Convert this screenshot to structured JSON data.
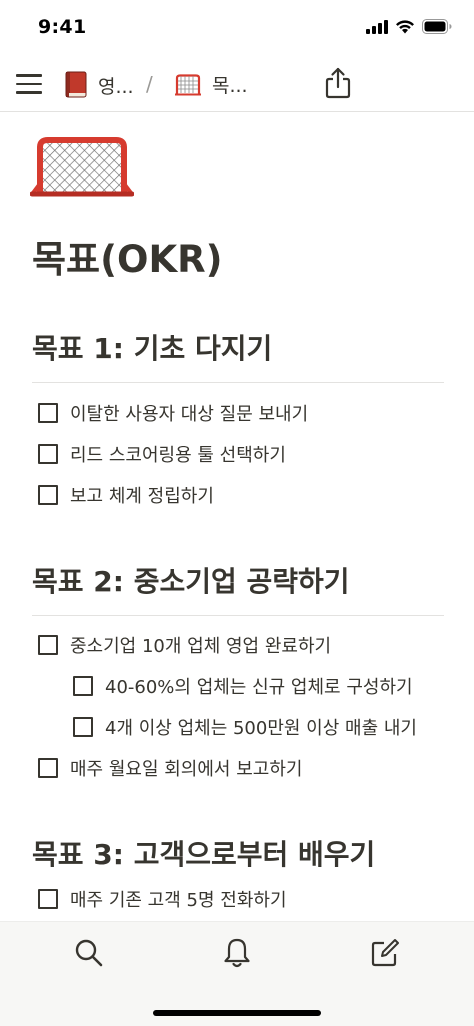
{
  "status": {
    "time": "9:41"
  },
  "nav": {
    "breadcrumbs": [
      {
        "icon": "red-book-icon",
        "label": "영..."
      },
      {
        "icon": "goal-net-icon",
        "label": "목..."
      }
    ],
    "separator": "/"
  },
  "page": {
    "icon": "goal-net-icon",
    "title": "목표(OKR)"
  },
  "sections": [
    {
      "heading": "목표 1: 기초 다지기",
      "todos": [
        {
          "text": "이탈한 사용자 대상 질문 보내기",
          "checked": false
        },
        {
          "text": "리드 스코어링용 툴 선택하기",
          "checked": false
        },
        {
          "text": "보고 체계 정립하기",
          "checked": false
        }
      ]
    },
    {
      "heading": "목표 2: 중소기업 공략하기",
      "todos": [
        {
          "text": "중소기업 10개 업체 영업 완료하기",
          "checked": false
        },
        {
          "text": "40-60%의 업체는 신규 업체로 구성하기",
          "checked": false,
          "indent": 1
        },
        {
          "text": "4개 이상 업체는 500만원 이상 매출 내기",
          "checked": false,
          "indent": 1
        },
        {
          "text": "매주 월요일 회의에서 보고하기",
          "checked": false
        }
      ]
    },
    {
      "heading": "목표 3: 고객으로부터 배우기",
      "todos": [
        {
          "text": "매주 기존 고객 5명 전화하기",
          "checked": false
        }
      ]
    }
  ],
  "bottom_tabs": [
    "search-icon",
    "bell-icon",
    "compose-icon"
  ]
}
